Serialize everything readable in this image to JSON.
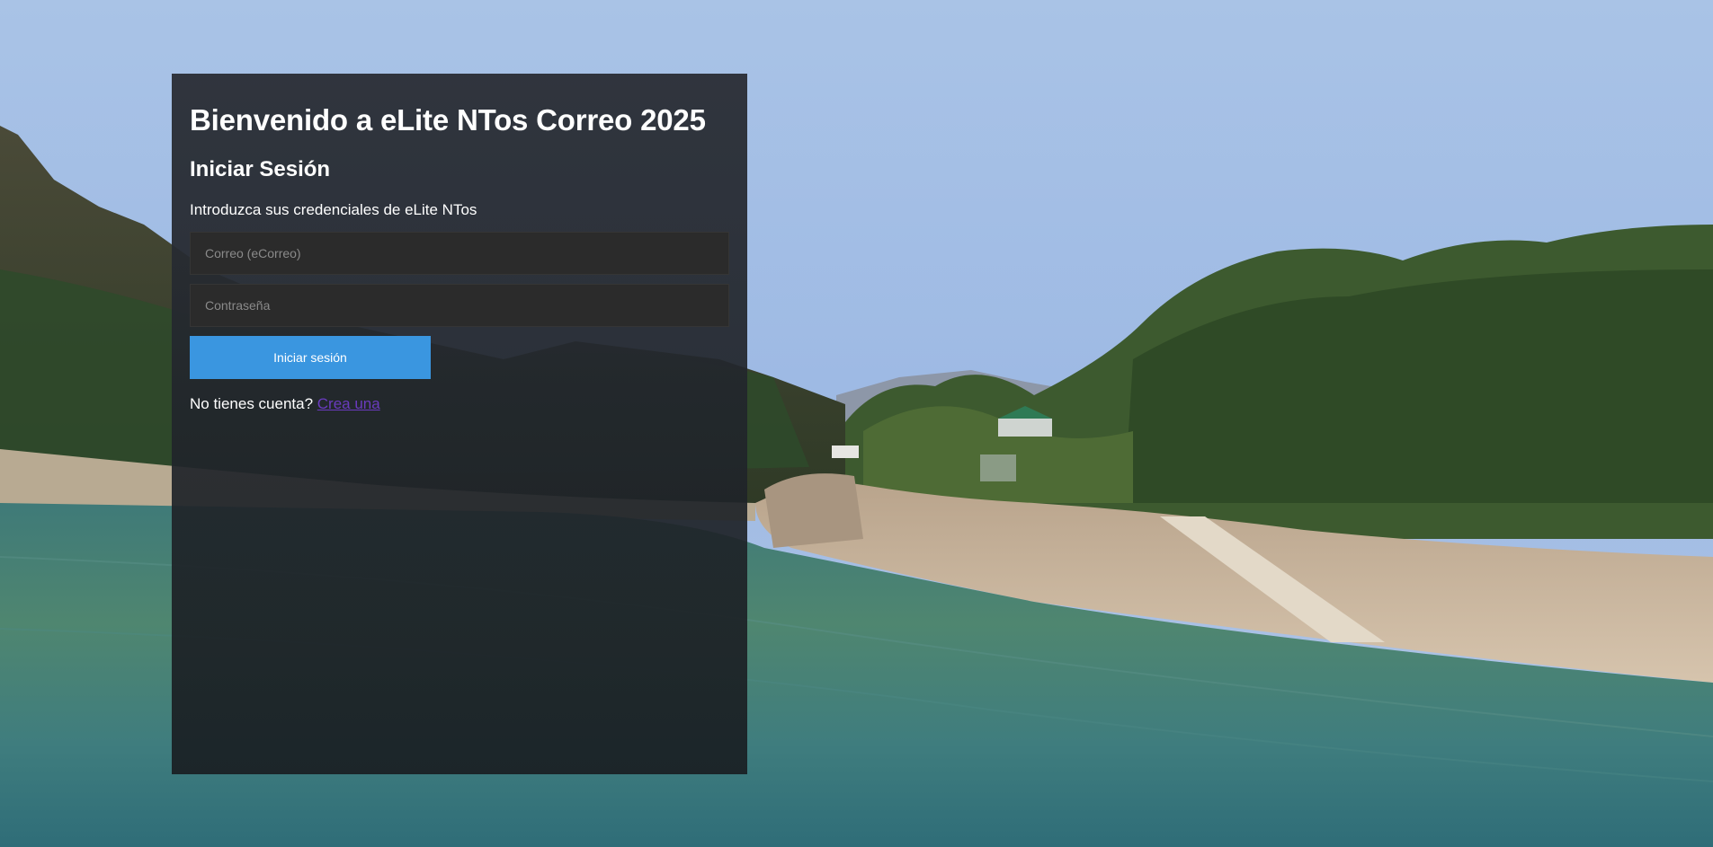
{
  "login": {
    "welcome_title": "Bienvenido a eLite NTos Correo 2025",
    "heading": "Iniciar Sesión",
    "subtitle": "Introduzca sus credenciales de eLite NTos",
    "email_placeholder": "Correo (eCorreo)",
    "email_value": "",
    "password_placeholder": "Contraseña",
    "password_value": "",
    "submit_label": "Iniciar sesión",
    "no_account_text": "No tienes cuenta?",
    "create_account_link": "Crea una"
  },
  "colors": {
    "accent_button": "#3a96e0",
    "link": "#6a3bbf",
    "panel_background": "#2c3038",
    "input_background": "#2b2b2b"
  }
}
